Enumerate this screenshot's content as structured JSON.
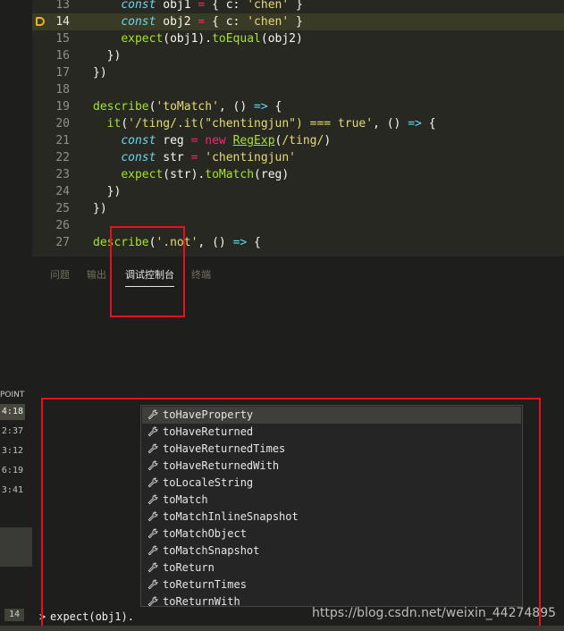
{
  "editor": {
    "current_line": "14",
    "lines": [
      {
        "num": "13",
        "tokens": [
          {
            "t": "    "
          },
          {
            "t": "const",
            "c": "kw"
          },
          {
            "t": " obj1 "
          },
          {
            "t": "=",
            "c": "op"
          },
          {
            "t": " { c: "
          },
          {
            "t": "'chen'",
            "c": "str"
          },
          {
            "t": " }"
          }
        ]
      },
      {
        "num": "14",
        "tokens": [
          {
            "t": "    "
          },
          {
            "t": "const",
            "c": "kw"
          },
          {
            "t": " obj2 "
          },
          {
            "t": "=",
            "c": "op"
          },
          {
            "t": " { c: "
          },
          {
            "t": "'chen'",
            "c": "str"
          },
          {
            "t": " }"
          }
        ]
      },
      {
        "num": "15",
        "tokens": [
          {
            "t": "    "
          },
          {
            "t": "expect",
            "c": "fn"
          },
          {
            "t": "(obj1)."
          },
          {
            "t": "toEqual",
            "c": "fn"
          },
          {
            "t": "(obj2)"
          }
        ]
      },
      {
        "num": "16",
        "tokens": [
          {
            "t": "  })"
          }
        ]
      },
      {
        "num": "17",
        "tokens": [
          {
            "t": "})"
          }
        ]
      },
      {
        "num": "18",
        "tokens": []
      },
      {
        "num": "19",
        "tokens": [
          {
            "t": "describe",
            "c": "fn"
          },
          {
            "t": "("
          },
          {
            "t": "'toMatch'",
            "c": "str"
          },
          {
            "t": ", () "
          },
          {
            "t": "=>",
            "c": "kw"
          },
          {
            "t": " {"
          }
        ]
      },
      {
        "num": "20",
        "tokens": [
          {
            "t": "  "
          },
          {
            "t": "it",
            "c": "fn"
          },
          {
            "t": "("
          },
          {
            "t": "'/ting/.it(\"chentingjun\") === true'",
            "c": "str"
          },
          {
            "t": ", () "
          },
          {
            "t": "=>",
            "c": "kw"
          },
          {
            "t": " {"
          }
        ]
      },
      {
        "num": "21",
        "tokens": [
          {
            "t": "    "
          },
          {
            "t": "const",
            "c": "kw"
          },
          {
            "t": " reg "
          },
          {
            "t": "=",
            "c": "op"
          },
          {
            "t": " "
          },
          {
            "t": "new",
            "c": "op"
          },
          {
            "t": " "
          },
          {
            "t": "RegExp",
            "c": "cls"
          },
          {
            "t": "("
          },
          {
            "t": "/ting/",
            "c": "str"
          },
          {
            "t": ")"
          }
        ]
      },
      {
        "num": "22",
        "tokens": [
          {
            "t": "    "
          },
          {
            "t": "const",
            "c": "kw"
          },
          {
            "t": " str "
          },
          {
            "t": "=",
            "c": "op"
          },
          {
            "t": " "
          },
          {
            "t": "'chentingjun'",
            "c": "str"
          }
        ]
      },
      {
        "num": "23",
        "tokens": [
          {
            "t": "    "
          },
          {
            "t": "expect",
            "c": "fn"
          },
          {
            "t": "(str)."
          },
          {
            "t": "toMatch",
            "c": "fn"
          },
          {
            "t": "(reg)"
          }
        ]
      },
      {
        "num": "24",
        "tokens": [
          {
            "t": "  })"
          }
        ]
      },
      {
        "num": "25",
        "tokens": [
          {
            "t": "})"
          }
        ]
      },
      {
        "num": "26",
        "tokens": []
      },
      {
        "num": "27",
        "tokens": [
          {
            "t": "describe",
            "c": "fn"
          },
          {
            "t": "("
          },
          {
            "t": "'.not'",
            "c": "str"
          },
          {
            "t": ", () "
          },
          {
            "t": "=>",
            "c": "kw"
          },
          {
            "t": " {"
          }
        ]
      }
    ]
  },
  "panel": {
    "tabs": [
      {
        "label": "问题",
        "active": false
      },
      {
        "label": "输出",
        "active": false
      },
      {
        "label": "调试控制台",
        "active": true
      },
      {
        "label": "终端",
        "active": false
      }
    ]
  },
  "debug": {
    "breakpoints_header": "POINT",
    "timestamps": [
      "4:18",
      "2:37",
      "3:12",
      "6:19",
      "3:41"
    ],
    "line_badge": "14"
  },
  "console": {
    "prompt": ">",
    "input": "expect(obj1).",
    "suggestions": [
      "toHaveProperty",
      "toHaveReturned",
      "toHaveReturnedTimes",
      "toHaveReturnedWith",
      "toLocaleString",
      "toMatch",
      "toMatchInlineSnapshot",
      "toMatchObject",
      "toMatchSnapshot",
      "toReturn",
      "toReturnTimes",
      "toReturnWith"
    ],
    "selected_suggestion": 0
  },
  "watermark": "https://blog.csdn.net/weixin_44274895",
  "colors": {
    "background": "#272822",
    "highlight_line": "#3a3b26",
    "annotation_box": "#e8101a",
    "breakpoint_marker": "#e6b422"
  }
}
